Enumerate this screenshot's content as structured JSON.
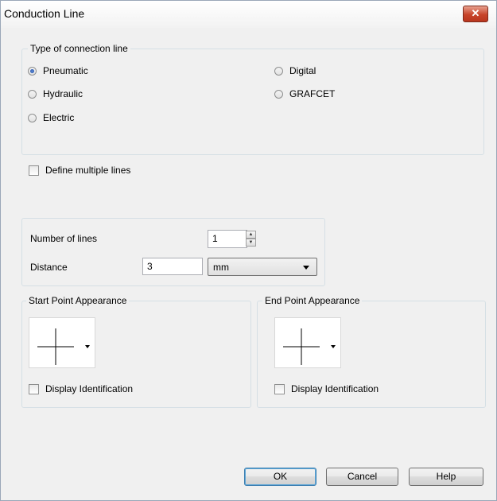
{
  "window": {
    "title": "Conduction Line",
    "close_glyph": "✕"
  },
  "connection_type": {
    "legend": "Type of connection line",
    "options": [
      {
        "label": "Pneumatic",
        "selected": true
      },
      {
        "label": "Hydraulic",
        "selected": false
      },
      {
        "label": "Electric",
        "selected": false
      },
      {
        "label": "Digital",
        "selected": false
      },
      {
        "label": "GRAFCET",
        "selected": false
      }
    ]
  },
  "multiple_lines": {
    "checkbox_label": "Define multiple lines",
    "checked": false,
    "number_label": "Number of lines",
    "number_value": "1",
    "distance_label": "Distance",
    "distance_value": "3",
    "unit_value": "mm"
  },
  "start_point": {
    "legend": "Start Point Appearance",
    "checkbox_label": "Display Identification",
    "checked": false,
    "icon": "crosshair-icon"
  },
  "end_point": {
    "legend": "End Point Appearance",
    "checkbox_label": "Display Identification",
    "checked": false,
    "icon": "crosshair-icon"
  },
  "buttons": {
    "ok": "OK",
    "cancel": "Cancel",
    "help": "Help"
  },
  "colors": {
    "accent": "#3c7fb1",
    "close": "#c7442a",
    "dialog_bg": "#f0f0f0"
  }
}
